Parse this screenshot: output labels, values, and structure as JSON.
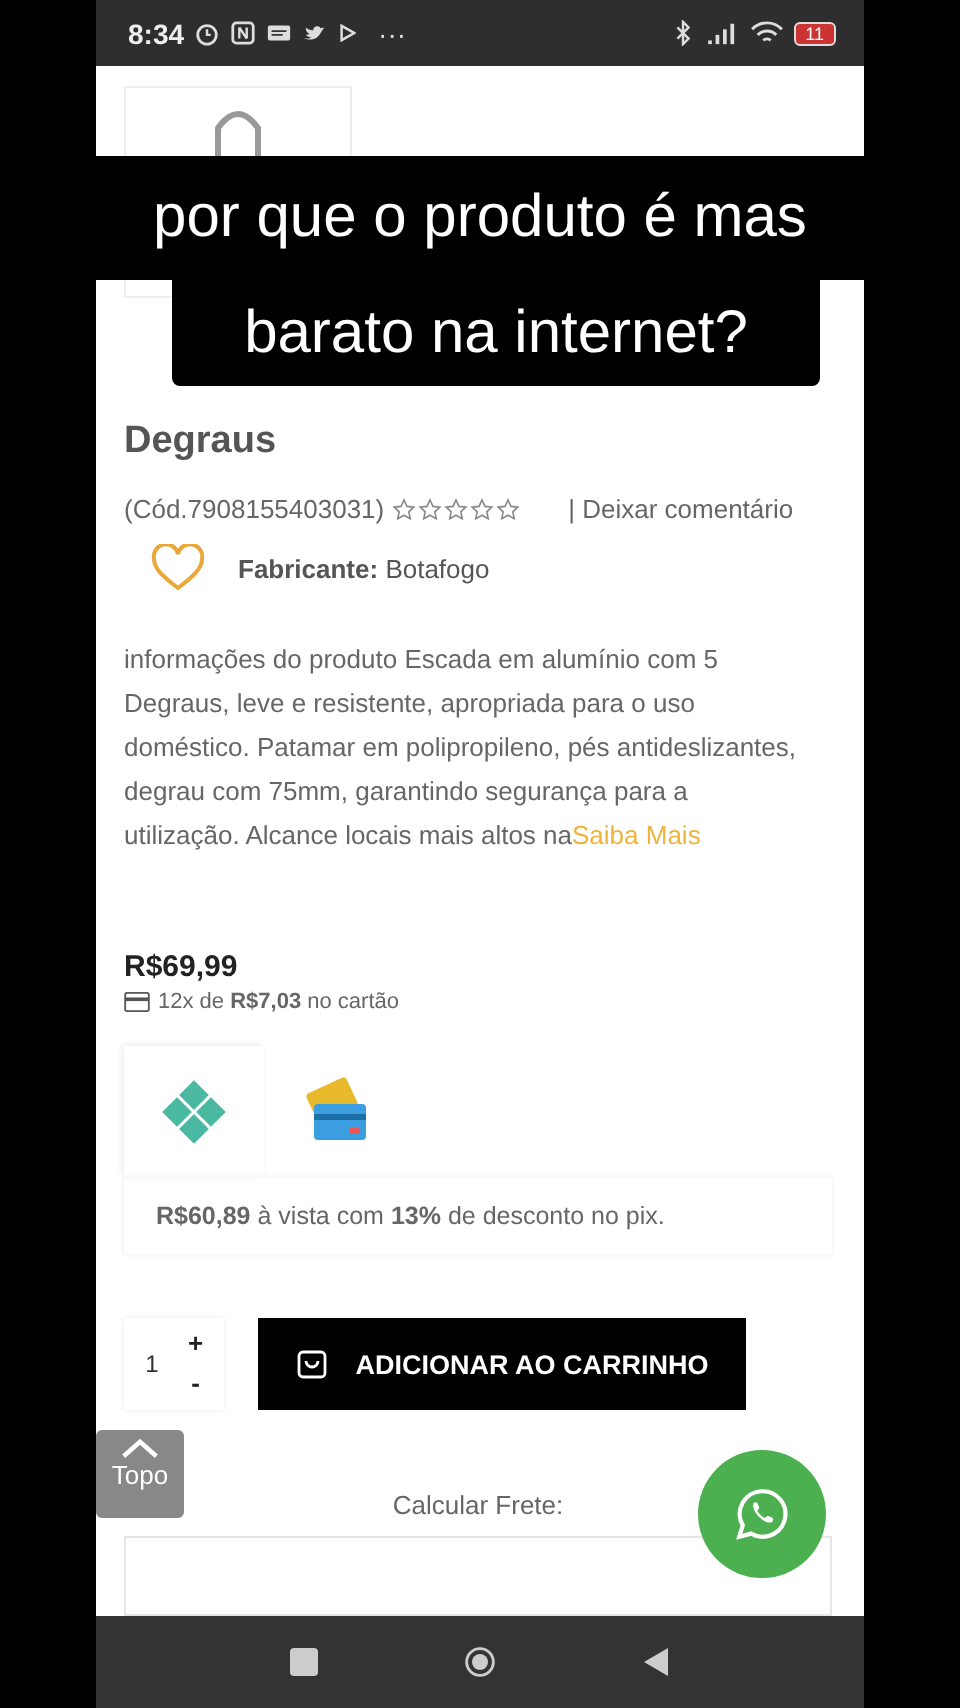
{
  "status_bar": {
    "time": "8:34",
    "more": "···",
    "battery": "11"
  },
  "caption": [
    "por que o produto é mas",
    "barato na internet?"
  ],
  "product": {
    "title": "Degraus",
    "code": "(Cód.7908155403031)",
    "stars": 0,
    "comment_link": "| Deixar comentário",
    "manufacturer": "**Fabricante:** Botafogo",
    "description": "informações do produto Escada em alumínio com 5 Degraus, leve e resistente, apropriada para o uso doméstico. Patamar em polipropileno, pés antideslizantes, degrau com 75mm, garantindo segurança para a utilização. Alcance locais mais altos na",
    "more_link": "Saiba Mais"
  },
  "price": {
    "value": "R$69,99",
    "installment": "12x de **R$7,03** no cartão"
  },
  "payment_tabs": [
    {
      "kind": "pix",
      "selected": true
    },
    {
      "kind": "card",
      "selected": false
    }
  ],
  "pix_offer": "**R$60,89** à vista com **13%** de desconto no pix.",
  "cart": {
    "quantity": "1",
    "plus": "+",
    "minus": "-",
    "button": "ADICIONAR AO CARRINHO"
  },
  "shipping": {
    "label": "Calcular Frete:"
  },
  "top_button": "Topo"
}
